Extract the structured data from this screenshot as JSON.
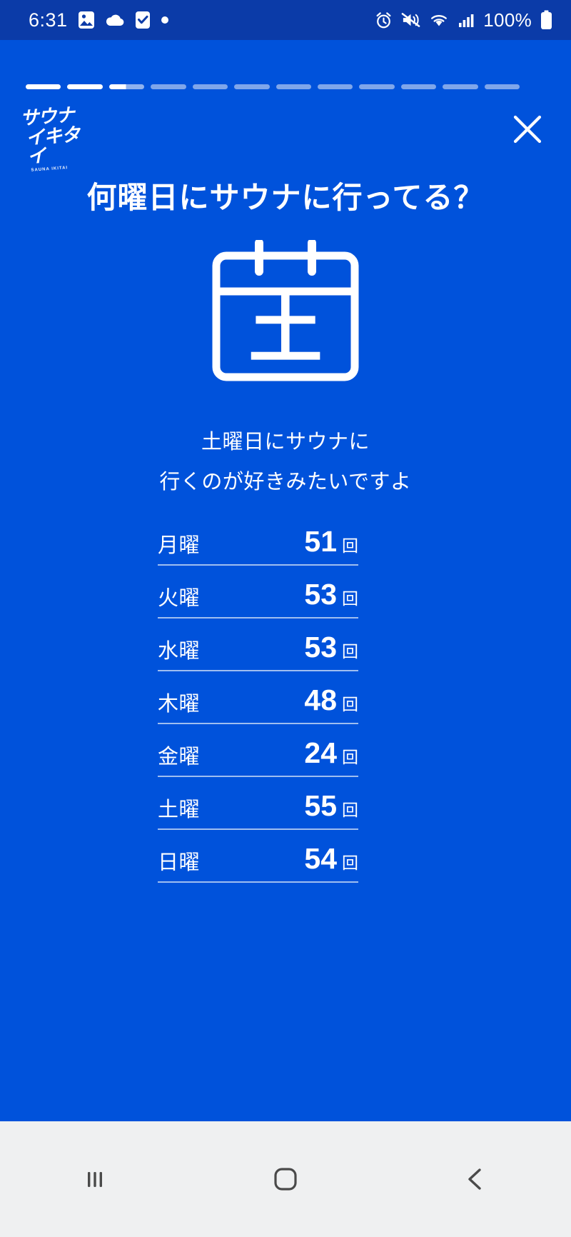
{
  "status_bar": {
    "time": "6:31",
    "battery_percent": "100%",
    "left_icons": [
      "photo-icon",
      "cloud-icon",
      "task-check-icon",
      "dot-icon"
    ],
    "right_icons": [
      "alarm-icon",
      "volume-mute-icon",
      "wifi-icon",
      "signal-icon",
      "battery-icon"
    ],
    "background_color": "#0B3BA8"
  },
  "screen": {
    "background_color": "#0052DB",
    "accent_color": "#FFFFFF",
    "divider_color": "#9FBEF0"
  },
  "progress": {
    "total_segments": 12,
    "filled_segments": 2,
    "partial_segment_index": 2
  },
  "header": {
    "logo_line1": "サウナ",
    "logo_line2": "イキタイ",
    "logo_sub": "SAUNA IKITAI",
    "close_label": "close-icon"
  },
  "title": "何曜日にサウナに行ってる？",
  "illustration": {
    "icon": "calendar-icon",
    "calendar_day_char": "土"
  },
  "subtitle": {
    "line1": "土曜日にサウナに",
    "line2": "行くのが好きみたいですよ"
  },
  "chart_data": {
    "type": "table",
    "title": "何曜日にサウナに行ってる？",
    "xlabel": "",
    "ylabel": "回",
    "unit": "回",
    "categories": [
      "月曜",
      "火曜",
      "水曜",
      "木曜",
      "金曜",
      "土曜",
      "日曜"
    ],
    "values": [
      51,
      53,
      53,
      48,
      24,
      55,
      54
    ],
    "max_category": "土曜",
    "max_value": 55
  },
  "rows": [
    {
      "day": "月曜",
      "value": "51",
      "unit": "回"
    },
    {
      "day": "火曜",
      "value": "53",
      "unit": "回"
    },
    {
      "day": "水曜",
      "value": "53",
      "unit": "回"
    },
    {
      "day": "木曜",
      "value": "48",
      "unit": "回"
    },
    {
      "day": "金曜",
      "value": "24",
      "unit": "回"
    },
    {
      "day": "土曜",
      "value": "55",
      "unit": "回"
    },
    {
      "day": "日曜",
      "value": "54",
      "unit": "回"
    }
  ],
  "navbar": {
    "recents_label": "recents-icon",
    "home_label": "home-icon",
    "back_label": "back-icon",
    "background_color": "#EFF0F1",
    "icon_color": "#4A4A4A"
  }
}
